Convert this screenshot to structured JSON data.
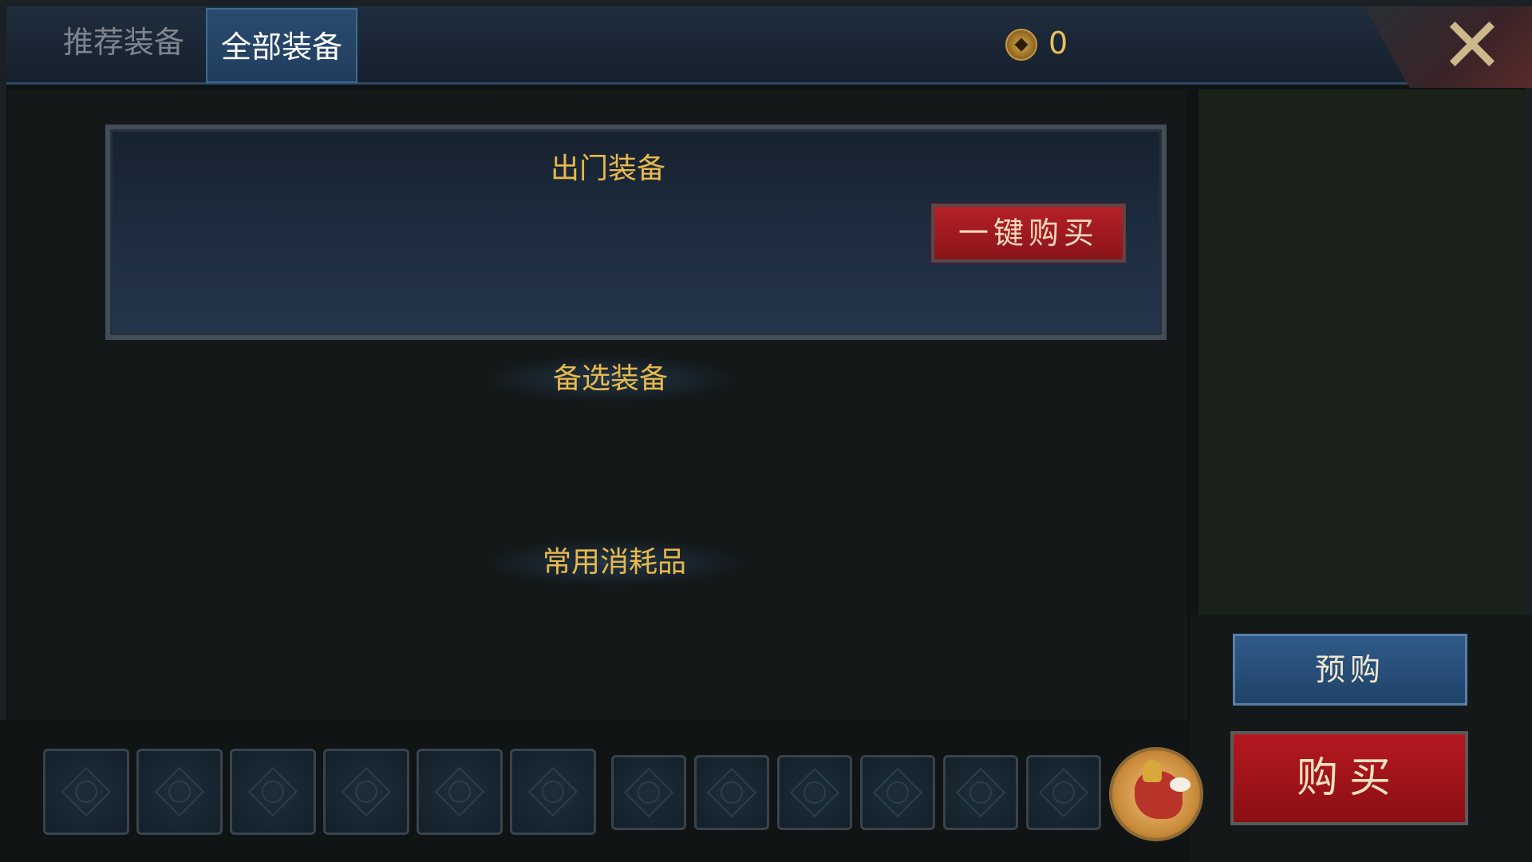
{
  "tabs": [
    {
      "label": "推荐装备",
      "active": false
    },
    {
      "label": "全部装备",
      "active": true
    }
  ],
  "currency": {
    "icon": "coin-icon",
    "amount": "0"
  },
  "close": {
    "icon": "close-icon"
  },
  "starting_equipment": {
    "title": "出门装备",
    "buy_all_label": "一键购买"
  },
  "sections": {
    "alternative": "备选装备",
    "consumables": "常用消耗品"
  },
  "actions": {
    "prebuy_label": "预购",
    "buy_label": "购买"
  },
  "slots": {
    "large_count": 6,
    "small_count": 6,
    "pet_icon": "winged-horse-pet-icon"
  },
  "colors": {
    "accent_gold": "#e8b94a",
    "buy_red": "#b5191f",
    "prebuy_blue": "#2f5a88"
  }
}
